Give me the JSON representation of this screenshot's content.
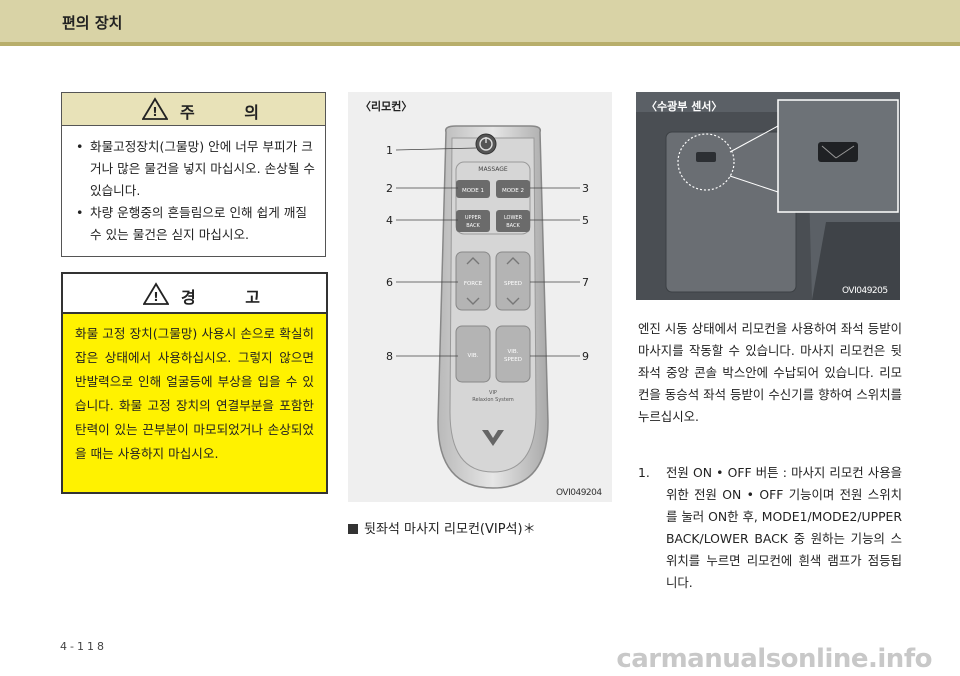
{
  "header": {
    "title": "편의 장치"
  },
  "caution": {
    "title": "주 의",
    "items": [
      "화물고정장치(그물망) 안에 너무 부피가 크거나 많은 물건을 넣지 마십시오. 손상될 수 있습니다.",
      "차량 운행중의 흔들림으로 인해 쉽게 깨질 수 있는 물건은 싣지 마십시오."
    ]
  },
  "warning": {
    "title": "경 고",
    "text": "화물 고정 장치(그물망) 사용시 손으로 확실히 잡은 상태에서 사용하십시오. 그렇지 않으면 반발력으로 인해 얼굴등에 부상을 입을 수 있습니다. 화물 고정 장치의 연결부분을 포함한 탄력이 있는 끈부분이 마모되었거나 손상되었을 때는 사용하지 마십시오."
  },
  "remote": {
    "label": "〈리모컨〉",
    "code": "OVI049204",
    "massage": "MASSAGE",
    "buttons": {
      "mode1": "MODE 1",
      "mode2": "MODE 2",
      "upper": "UPPER BACK",
      "lower": "LOWER BACK",
      "force": "FORCE",
      "speed": "SPEED",
      "vib": "VIB.",
      "vibspeed": "VIB. SPEED",
      "system": "VIP Relaxion System"
    },
    "callouts": [
      "1",
      "2",
      "3",
      "4",
      "5",
      "6",
      "7",
      "8",
      "9"
    ]
  },
  "caption": "뒷좌석 마사지 리모컨(VIP석)＊",
  "sensor": {
    "label": "〈수광부 센서〉",
    "code": "OVI049205"
  },
  "body": {
    "paragraph": "엔진 시동 상태에서 리모컨을 사용하여 좌석 등받이 마사지를 작동할 수 있습니다. 마사지 리모컨은 뒷좌석 중앙 콘솔 박스안에 수납되어 있습니다. 리모컨을 동승석 좌석 등받이 수신기를 향하여 스위치를 누르십시오.",
    "item1_num": "1.",
    "item1_text": "전원 ON • OFF 버튼 : 마사지 리모컨 사용을 위한 전원 ON • OFF 기능이며 전원 스위치를 눌러 ON한 후, MODE1/MODE2/UPPER BACK/LOWER BACK 중 원하는 기능의 스위치를 누르면 리모컨에 흰색 램프가 점등됩니다."
  },
  "page_number": "4-118",
  "watermark": "carmanualsonline.info"
}
